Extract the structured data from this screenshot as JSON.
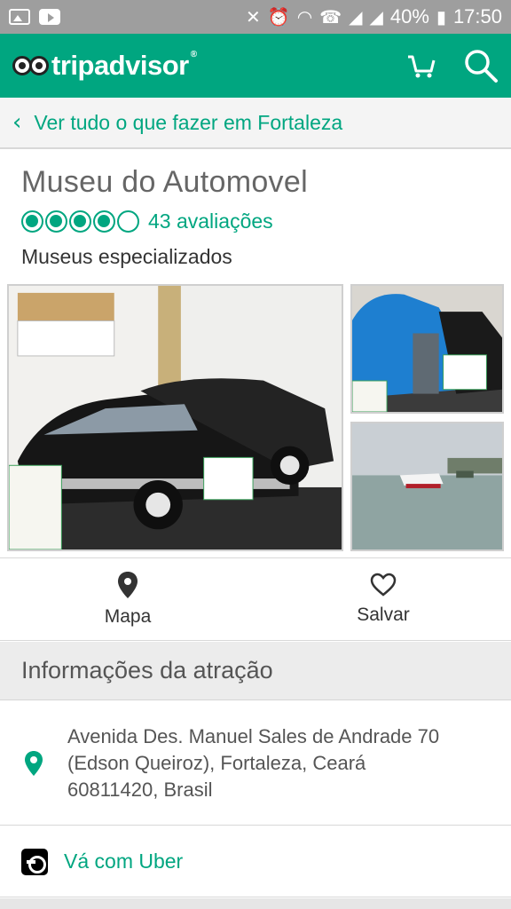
{
  "status_bar": {
    "battery": "40%",
    "time": "17:50"
  },
  "app_bar": {
    "logo_trip": "trip",
    "logo_advisor": "advisor",
    "logo_registered": "®",
    "cart_icon": "cart-icon",
    "search_icon": "search-icon"
  },
  "breadcrumb": {
    "chevron": "‹",
    "label": "Ver tudo o que fazer em Fortaleza"
  },
  "attraction": {
    "title": "Museu do Automovel",
    "rating": 4,
    "rating_max": 5,
    "reviews_label": "43 avaliações",
    "category": "Museus especializados"
  },
  "actions": {
    "map_label": "Mapa",
    "save_label": "Salvar"
  },
  "info_section": {
    "header": "Informações da atração",
    "address_line1": "Avenida Des. Manuel Sales de Andrade 70",
    "address_line2": "(Edson Queiroz), Fortaleza, Ceará",
    "address_line3": "60811420, Brasil"
  },
  "uber": {
    "label": "Vá com Uber"
  },
  "colors": {
    "brand_green": "#00a680",
    "status_bar_grey": "#9e9e9e"
  }
}
